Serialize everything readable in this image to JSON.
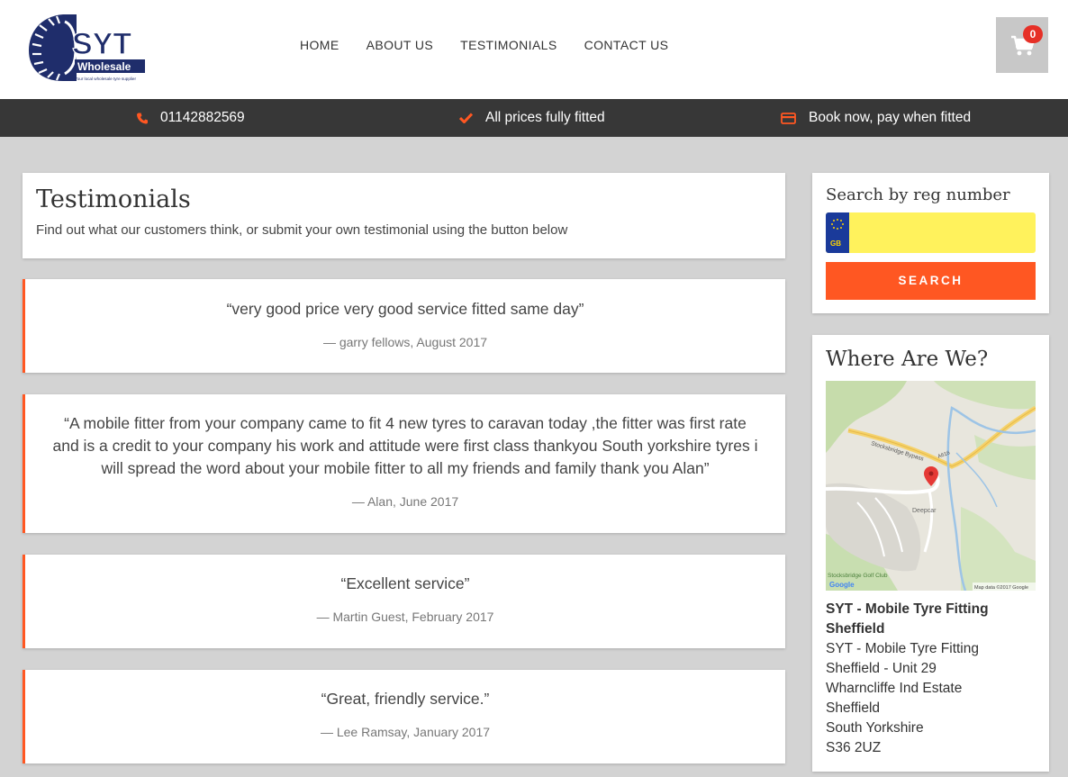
{
  "brand": {
    "logo_text": "SYT",
    "logo_sub": "Wholesale",
    "logo_tagline": "Your local wholesale tyre supplier"
  },
  "nav": [
    {
      "label": "HOME"
    },
    {
      "label": "ABOUT US"
    },
    {
      "label": "TESTIMONIALS"
    },
    {
      "label": "CONTACT US"
    }
  ],
  "cart": {
    "count": "0",
    "icon": "cart-icon"
  },
  "infobar": {
    "phone": "01142882569",
    "fitted": "All prices fully fitted",
    "book": "Book now, pay when fitted"
  },
  "page": {
    "title": "Testimonials",
    "subtitle": "Find out what our customers think, or submit your own testimonial using the button below"
  },
  "testimonials": [
    {
      "quote": "“very good price very good service fitted same day”",
      "cite": "— garry fellows, August 2017"
    },
    {
      "quote": "“A mobile fitter from your company came to fit 4 new tyres to caravan today ,the fitter was first rate and is a credit to your company his work and attitude were first class thankyou South yorkshire tyres i will spread the word about your mobile fitter to all my friends and family thank you Alan”",
      "cite": "— Alan, June 2017"
    },
    {
      "quote": "“Excellent service”",
      "cite": "— Martin Guest, February 2017"
    },
    {
      "quote": "“Great, friendly service.”",
      "cite": "— Lee Ramsay, January 2017"
    }
  ],
  "reg_search": {
    "title": "Search by reg number",
    "gb_label": "GB",
    "value": "",
    "button": "SEARCH"
  },
  "location": {
    "title": "Where Are We?",
    "map_labels": {
      "bypass": "Stocksbridge Bypass",
      "road": "A616",
      "town": "Deepcar",
      "golf": "Stocksbridge Golf Club",
      "google": "Google",
      "credit": "Map data ©2017 Google"
    },
    "name_line1": "SYT - Mobile Tyre Fitting",
    "name_line2": "Sheffield",
    "address_lines": [
      "SYT - Mobile Tyre Fitting",
      "Sheffield - Unit 29",
      "Wharncliffe Ind Estate",
      "Sheffield",
      "South Yorkshire",
      "S36 2UZ"
    ]
  },
  "colors": {
    "accent": "#ff5722",
    "infobar": "#373737",
    "background": "#d3d3d3",
    "brand_blue": "#1f2d6b"
  }
}
